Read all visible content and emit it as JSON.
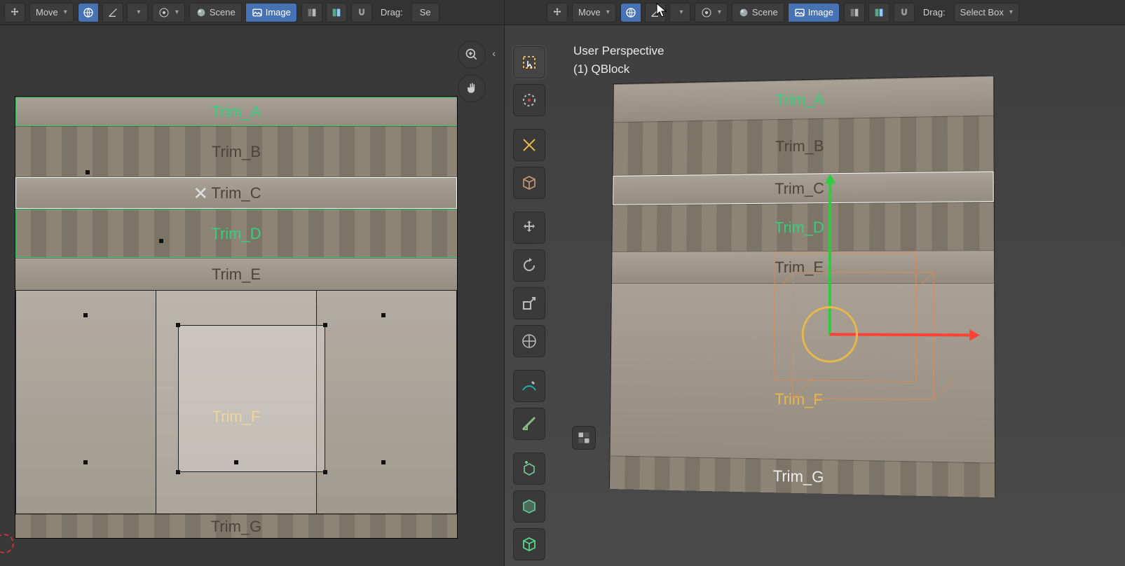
{
  "left_header": {
    "tool_label": "Move",
    "scene_label": "Scene",
    "image_label": "Image",
    "drag_label": "Drag:",
    "drag_value": "Se"
  },
  "right_header": {
    "tool_label": "Move",
    "scene_label": "Scene",
    "image_label": "Image",
    "drag_label": "Drag:",
    "drag_value": "Select Box"
  },
  "right_info": {
    "line1": "User Perspective",
    "line2": "(1) QBlock"
  },
  "trims": {
    "a": "Trim_A",
    "b": "Trim_B",
    "c": "Trim_C",
    "d": "Trim_D",
    "e": "Trim_E",
    "f": "Trim_F",
    "g": "Trim_G"
  }
}
